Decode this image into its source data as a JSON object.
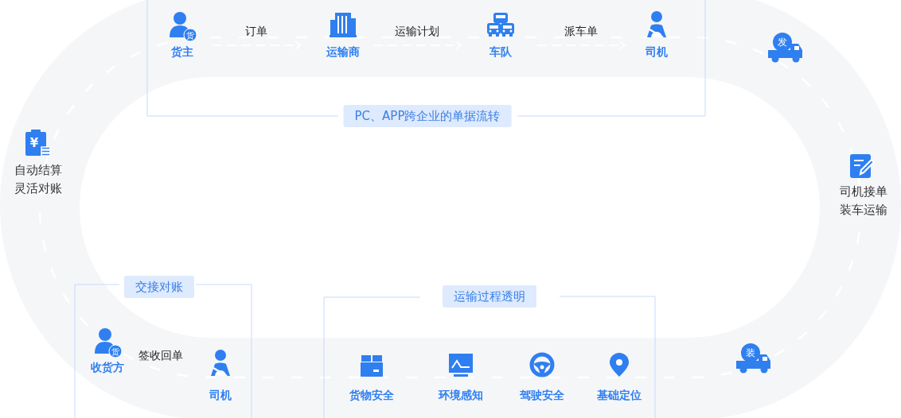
{
  "top_flow": {
    "nodes": [
      {
        "label": "货主",
        "kind": "shipper",
        "badge": "货"
      },
      {
        "label": "运输商",
        "kind": "carrier"
      },
      {
        "label": "车队",
        "kind": "fleet"
      },
      {
        "label": "司机",
        "kind": "driver"
      }
    ],
    "documents": [
      "订单",
      "运输计划",
      "派车单"
    ],
    "caption": "PC、APP跨企业的单据流转"
  },
  "trucks": [
    {
      "badge": "发"
    },
    {
      "badge": "装"
    }
  ],
  "left_step": {
    "symbol": "¥",
    "lines": [
      "自动结算",
      "灵活对账"
    ]
  },
  "right_step": {
    "lines": [
      "司机接单",
      "装车运输"
    ]
  },
  "handover": {
    "caption": "交接对账",
    "nodes": [
      {
        "label": "收货方",
        "kind": "shipper",
        "badge": "货"
      },
      {
        "label": "司机",
        "kind": "driver"
      }
    ],
    "document": "签收回单"
  },
  "transparency": {
    "caption": "运输过程透明",
    "features": [
      {
        "label": "货物安全",
        "kind": "box"
      },
      {
        "label": "环境感知",
        "kind": "monitor"
      },
      {
        "label": "驾驶安全",
        "kind": "wheel"
      },
      {
        "label": "基础定位",
        "kind": "pin"
      }
    ]
  }
}
